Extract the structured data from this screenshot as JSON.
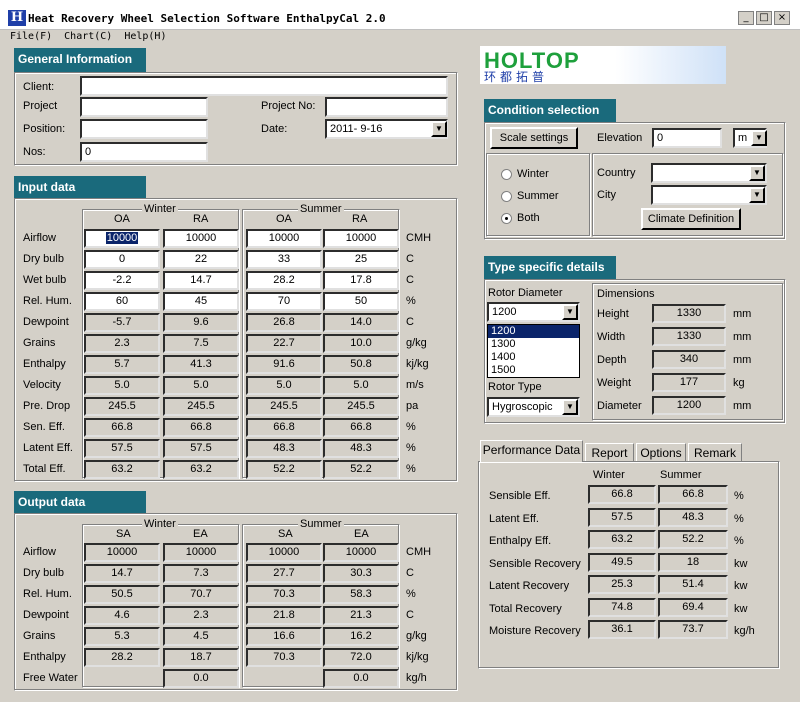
{
  "window": {
    "app_icon": "H",
    "title": "Heat Recovery Wheel Selection Software EnthalpyCal 2.0",
    "minimize": "_",
    "maximize": "□",
    "close": "×"
  },
  "menu": [
    "File(F)",
    "Chart(C)",
    "Help(H)"
  ],
  "logo": {
    "brand": "HOLTOP",
    "chinese": "环都拓普"
  },
  "general": {
    "header": "General Information",
    "client_label": "Client:",
    "project_label": "Project",
    "position_label": "Position:",
    "nos_label": "Nos:",
    "nos_value": "0",
    "project_no_label": "Project No:",
    "date_label": "Date:",
    "date_value": "2011- 9-16"
  },
  "input": {
    "header": "Input data",
    "winter": "Winter",
    "summer": "Summer",
    "cols": [
      "OA",
      "RA",
      "OA",
      "RA"
    ],
    "rows": [
      {
        "label": "Airflow",
        "v": [
          "10000",
          "10000",
          "10000",
          "10000"
        ],
        "unit": "CMH"
      },
      {
        "label": "Dry bulb",
        "v": [
          "0",
          "22",
          "33",
          "25"
        ],
        "unit": "C"
      },
      {
        "label": "Wet bulb",
        "v": [
          "-2.2",
          "14.7",
          "28.2",
          "17.8"
        ],
        "unit": "C"
      },
      {
        "label": "Rel. Hum.",
        "v": [
          "60",
          "45",
          "70",
          "50"
        ],
        "unit": "%"
      },
      {
        "label": "Dewpoint",
        "v": [
          "-5.7",
          "9.6",
          "26.8",
          "14.0"
        ],
        "unit": "C"
      },
      {
        "label": "Grains",
        "v": [
          "2.3",
          "7.5",
          "22.7",
          "10.0"
        ],
        "unit": "g/kg"
      },
      {
        "label": "Enthalpy",
        "v": [
          "5.7",
          "41.3",
          "91.6",
          "50.8"
        ],
        "unit": "kj/kg"
      },
      {
        "label": "Velocity",
        "v": [
          "5.0",
          "5.0",
          "5.0",
          "5.0"
        ],
        "unit": "m/s"
      },
      {
        "label": "Pre. Drop",
        "v": [
          "245.5",
          "245.5",
          "245.5",
          "245.5"
        ],
        "unit": "pa"
      },
      {
        "label": "Sen. Eff.",
        "v": [
          "66.8",
          "66.8",
          "66.8",
          "66.8"
        ],
        "unit": "%"
      },
      {
        "label": "Latent Eff.",
        "v": [
          "57.5",
          "57.5",
          "48.3",
          "48.3"
        ],
        "unit": "%"
      },
      {
        "label": "Total Eff.",
        "v": [
          "63.2",
          "63.2",
          "52.2",
          "52.2"
        ],
        "unit": "%"
      }
    ]
  },
  "output": {
    "header": "Output data",
    "winter": "Winter",
    "summer": "Summer",
    "cols": [
      "SA",
      "EA",
      "SA",
      "EA"
    ],
    "rows": [
      {
        "label": "Airflow",
        "v": [
          "10000",
          "10000",
          "10000",
          "10000"
        ],
        "unit": "CMH"
      },
      {
        "label": "Dry bulb",
        "v": [
          "14.7",
          "7.3",
          "27.7",
          "30.3"
        ],
        "unit": "C"
      },
      {
        "label": "Rel. Hum.",
        "v": [
          "50.5",
          "70.7",
          "70.3",
          "58.3"
        ],
        "unit": "%"
      },
      {
        "label": "Dewpoint",
        "v": [
          "4.6",
          "2.3",
          "21.8",
          "21.3"
        ],
        "unit": "C"
      },
      {
        "label": "Grains",
        "v": [
          "5.3",
          "4.5",
          "16.6",
          "16.2"
        ],
        "unit": "g/kg"
      },
      {
        "label": "Enthalpy",
        "v": [
          "28.2",
          "18.7",
          "70.3",
          "72.0"
        ],
        "unit": "kj/kg"
      },
      {
        "label": "Free Water",
        "v": [
          "",
          "0.0",
          "",
          "0.0"
        ],
        "unit": "kg/h"
      }
    ]
  },
  "condition": {
    "header": "Condition selection",
    "scale_button": "Scale settings",
    "elevation_label": "Elevation",
    "elevation_value": "0",
    "elevation_unit": "m",
    "season_options": [
      "Winter",
      "Summer",
      "Both"
    ],
    "selected_season": "Both",
    "country_label": "Country",
    "city_label": "City",
    "climate_button": "Climate Definition"
  },
  "type_specific": {
    "header": "Type specific details",
    "rotor_diameter_label": "Rotor Diameter",
    "rotor_diameter_value": "1200",
    "rotor_list": [
      "1200",
      "1300",
      "1400",
      "1500"
    ],
    "rotor_type_label": "Rotor Type",
    "rotor_type_value": "Hygroscopic",
    "dimensions_label": "Dimensions",
    "dims": [
      {
        "label": "Height",
        "value": "1330",
        "unit": "mm"
      },
      {
        "label": "Width",
        "value": "1330",
        "unit": "mm"
      },
      {
        "label": "Depth",
        "value": "340",
        "unit": "mm"
      },
      {
        "label": "Weight",
        "value": "177",
        "unit": "kg"
      },
      {
        "label": "Diameter",
        "value": "1200",
        "unit": "mm"
      }
    ]
  },
  "performance": {
    "tabs": [
      "Performance Data",
      "Report",
      "Options",
      "Remark"
    ],
    "winter": "Winter",
    "summer": "Summer",
    "rows": [
      {
        "label": "Sensible Eff.",
        "w": "66.8",
        "s": "66.8",
        "unit": "%"
      },
      {
        "label": "Latent Eff.",
        "w": "57.5",
        "s": "48.3",
        "unit": "%"
      },
      {
        "label": "Enthalpy Eff.",
        "w": "63.2",
        "s": "52.2",
        "unit": "%"
      },
      {
        "label": "Sensible Recovery",
        "w": "49.5",
        "s": "18",
        "unit": "kw"
      },
      {
        "label": "Latent Recovery",
        "w": "25.3",
        "s": "51.4",
        "unit": "kw"
      },
      {
        "label": "Total Recovery",
        "w": "74.8",
        "s": "69.4",
        "unit": "kw"
      },
      {
        "label": "Moisture Recovery",
        "w": "36.1",
        "s": "73.7",
        "unit": "kg/h"
      }
    ]
  }
}
